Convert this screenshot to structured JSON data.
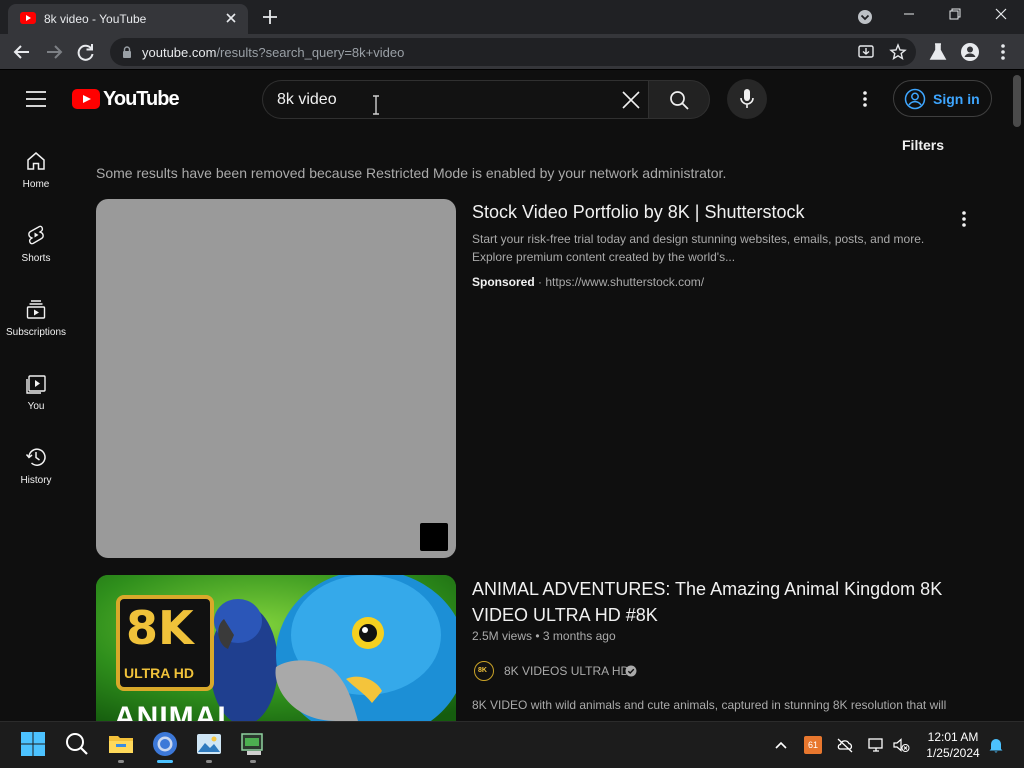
{
  "browser": {
    "tab_title": "8k video - YouTube",
    "url_host": "youtube.com",
    "url_path": "/results?search_query=8k+video"
  },
  "masthead": {
    "logo_text": "YouTube",
    "search_value": "8k video",
    "signin_label": "Sign in"
  },
  "sidebar": {
    "items": [
      {
        "label": "Home",
        "icon": "home-icon"
      },
      {
        "label": "Shorts",
        "icon": "shorts-icon"
      },
      {
        "label": "Subscriptions",
        "icon": "subscriptions-icon"
      },
      {
        "label": "You",
        "icon": "you-icon"
      },
      {
        "label": "History",
        "icon": "history-icon"
      }
    ]
  },
  "results": {
    "filters_label": "Filters",
    "restricted_notice": "Some results have been removed because Restricted Mode is enabled by your network administrator.",
    "ad": {
      "title": "Stock Video Portfolio by 8K | Shutterstock",
      "description": "Start your risk-free trial today and design stunning websites, emails, posts, and more. Explore premium content created by the world's...",
      "sponsored_label": "Sponsored",
      "separator": "·",
      "link": "https://www.shutterstock.com/"
    },
    "video": {
      "title": "ANIMAL ADVENTURES: The Amazing Animal Kingdom 8K VIDEO ULTRA HD #8K",
      "views": "2.5M views",
      "separator": "•",
      "age": "3 months ago",
      "channel": "8K VIDEOS ULTRA HD",
      "channel_avatar_text": "8K",
      "description": "8K VIDEO with wild animals and cute animals, captured in stunning 8K resolution that will",
      "thumb_badge_main": "8K",
      "thumb_badge_sub_1": "ULTRA",
      "thumb_badge_sub_2": "HD",
      "thumb_overlay_text": "ANIMAL"
    }
  },
  "taskbar": {
    "time": "12:01 AM",
    "date": "1/25/2024",
    "tray_badge": "61"
  },
  "colors": {
    "accent_blue": "#3ea6ff",
    "youtube_red": "#ff0000",
    "background": "#0f0f0f"
  }
}
